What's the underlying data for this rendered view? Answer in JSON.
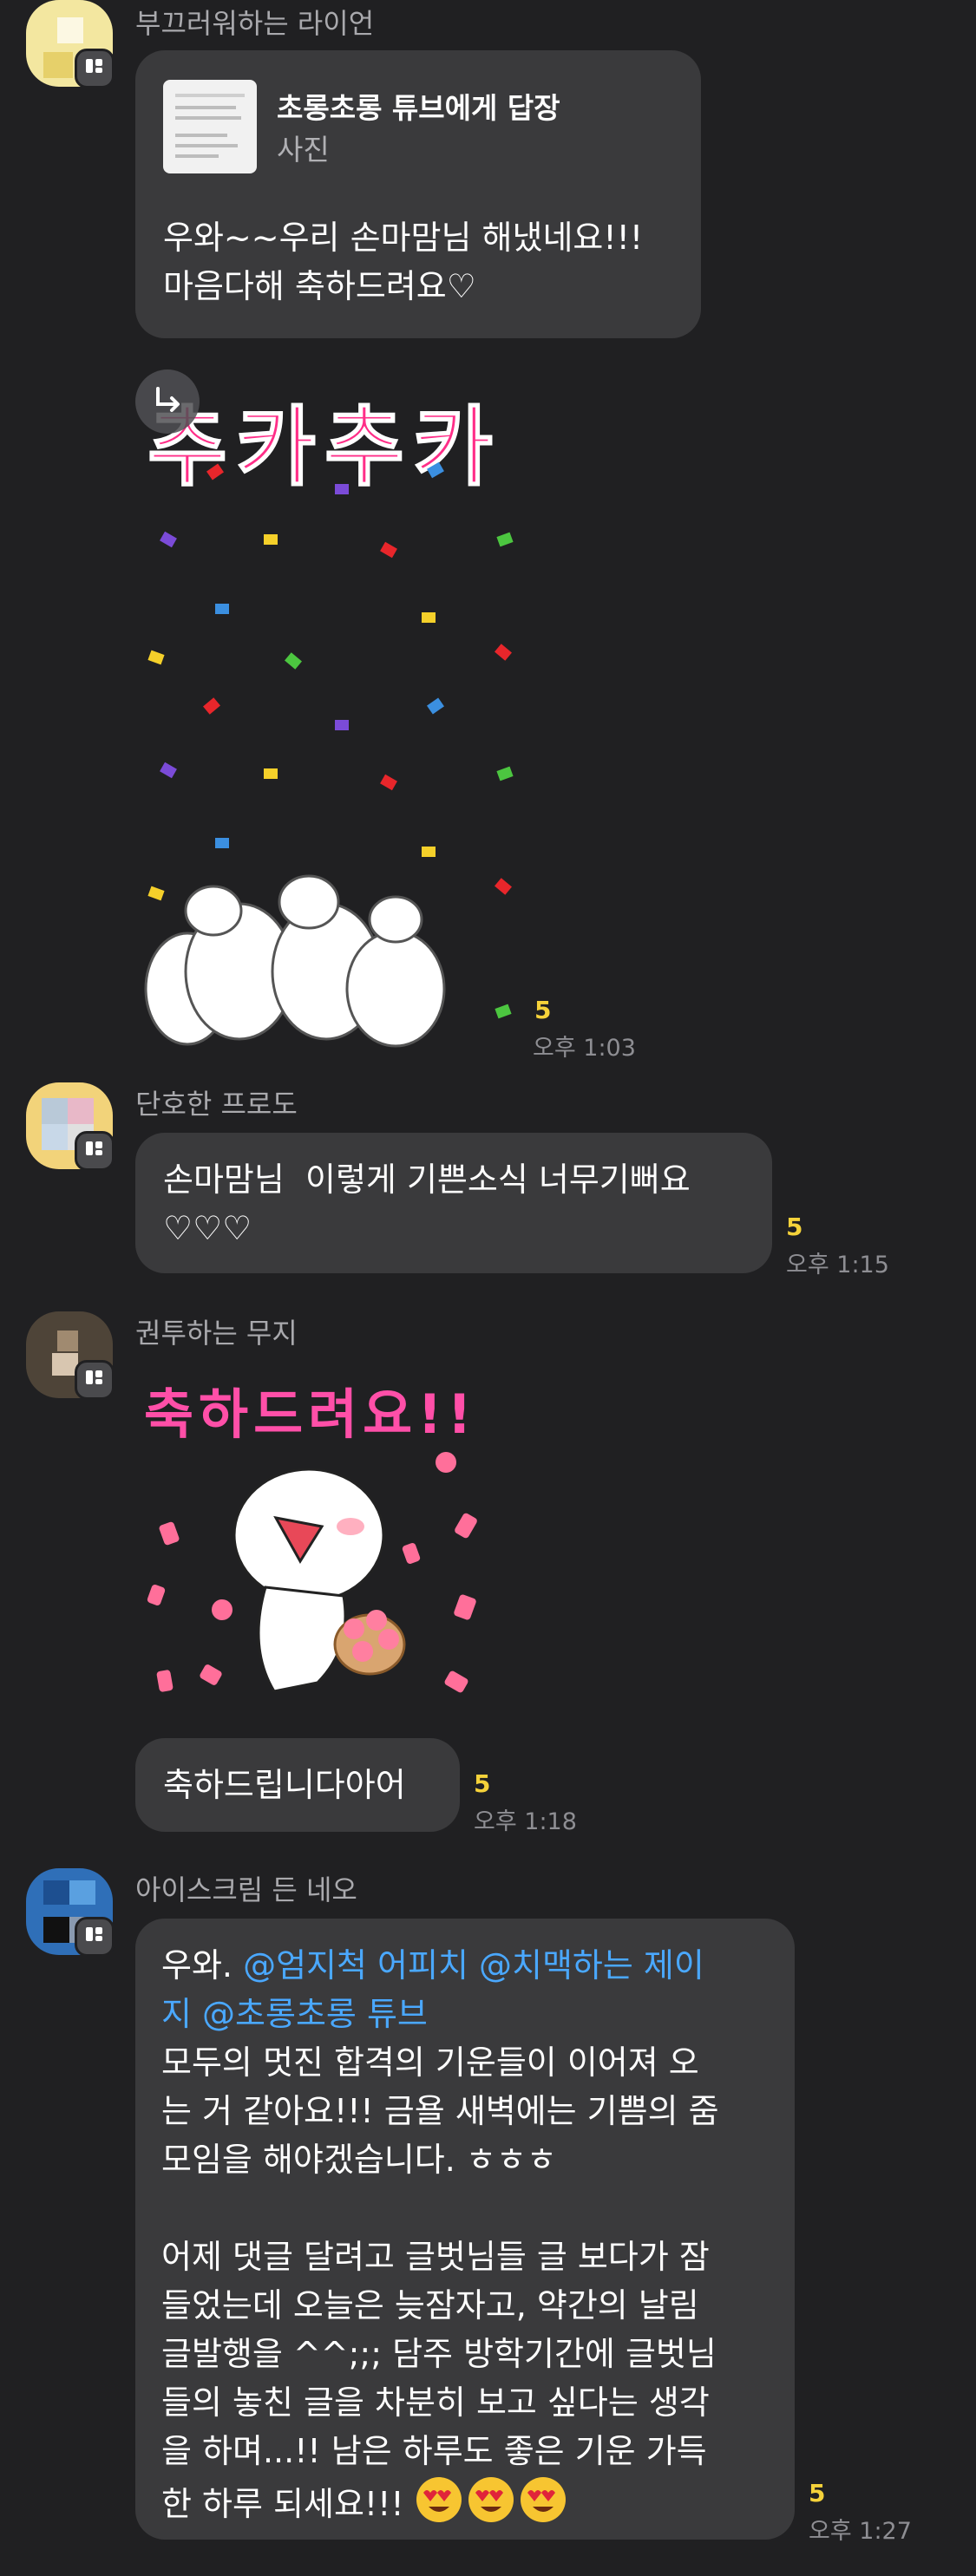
{
  "messages": {
    "m1": {
      "sender": "부끄러워하는 라이언",
      "reply_target": "초롱초롱 튜브에게 답장",
      "reply_type": "사진",
      "text": "우와~~우리 손마맘님 해냈네요!!!\n마음다해 축하드려요♡"
    },
    "m2": {
      "sticker_text": "추카추카",
      "unread": "5",
      "time": "오후 1:03"
    },
    "m3": {
      "sender": "단호한 프로도",
      "text": "손마맘님  이렇게 기쁜소식 너무기뻐요\n♡♡♡",
      "unread": "5",
      "time": "오후 1:15"
    },
    "m4": {
      "sender": "권투하는 무지",
      "sticker_text": "축하드려요!!",
      "text": "축하드립니다아어",
      "unread": "5",
      "time": "오후 1:18"
    },
    "m5": {
      "sender": "아이스크림 든 네오",
      "prefix": "우와. ",
      "mentions": "@엄지척 어피치 @치맥하는 제이\n지 @초롱초롱 튜브",
      "body": "모두의 멋진 합격의 기운들이 이어져 오\n는 거 같아요!!! 금욜 새벽에는 기쁨의 줌\n모임을 해야겠습니다. ㅎㅎㅎ\n\n어제 댓글 달려고 글벗님들 글 보다가 잠\n들었는데 오늘은 늦잠자고, 약간의 날림\n글발행을 ^^;;; 담주 방학기간에 글벗님\n들의 놓친 글을 차분히 보고 싶다는 생각\n을 하며...!! 남은 하루도 좋은 기운 가득\n한 하루 되세요!!! ",
      "unread": "5",
      "time": "오후 1:27"
    }
  },
  "colors": {
    "background": "#202022",
    "bubble": "#3a3a3c",
    "unread": "#f5d23a",
    "mention": "#4aa8ff"
  }
}
